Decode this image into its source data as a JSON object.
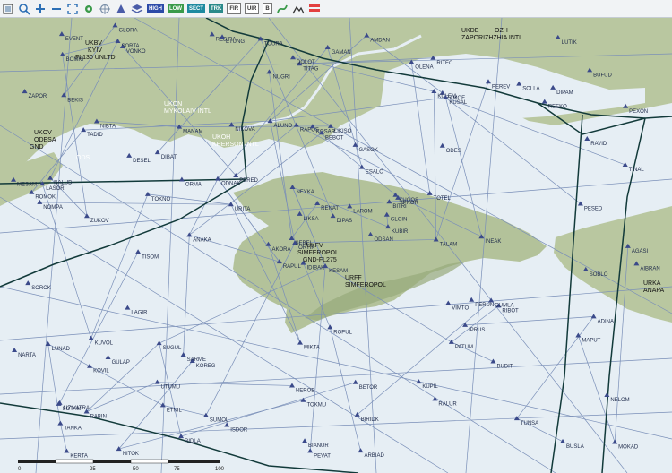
{
  "toolbar": {
    "icons": [
      "layers-icon",
      "search-icon",
      "zoom-in-icon",
      "zoom-out-icon",
      "fit-icon",
      "gear-icon",
      "target-icon",
      "triangle-icon",
      "layer-stack-icon"
    ],
    "buttons": [
      {
        "label": "HIGH",
        "color": "#2c4aa8"
      },
      {
        "label": "LOW",
        "color": "#3a9a4a"
      },
      {
        "label": "SECT",
        "color": "#1e8aa0"
      },
      {
        "label": "TRK",
        "color": "#2a8a8a"
      }
    ],
    "boxes": [
      "FIR",
      "UIR",
      "B"
    ],
    "right_icons": [
      "route-icon",
      "terrain-icon",
      "legend-icon"
    ]
  },
  "airports": [
    {
      "code": "UKBV",
      "name": "KYIV",
      "sub": "FL130 UNLTD"
    },
    {
      "code": "UKON",
      "name": "MYKOLAIV INTL"
    },
    {
      "code": "UKOH",
      "name": "KHERSON INTL"
    },
    {
      "code": "UKOV",
      "name": "ODESA",
      "sub": "GND"
    },
    {
      "code": "ODS",
      "name": "ODESA"
    },
    {
      "code": "UKDE",
      "name": "ZAPORIZHZHIA INTL",
      "code2": "OZH"
    },
    {
      "code": "UKFV",
      "name": "SIMFEROPOL",
      "sub": "GND-FL275"
    },
    {
      "code": "URFF",
      "name": "SIMFEROPOL"
    },
    {
      "code": "URKA",
      "name": "ANAPA"
    }
  ],
  "waypoints": [
    "KESAM",
    "TADID",
    "ORTIK",
    "LIZIVATRA",
    "BITRI",
    "KOREG",
    "RITEC",
    "LIKISO",
    "ZAMOE",
    "ODSAN",
    "VONKO",
    "MOKAD",
    "ZUKOV",
    "PEXON",
    "RAPUL",
    "ODES",
    "NITOK",
    "RAPOS",
    "ESALO",
    "GULAP",
    "PERED",
    "TANKA",
    "ETNIL",
    "KOSAR",
    "IPKOR",
    "RIBOT",
    "NIBTA",
    "TITAG",
    "NOMPA",
    "VIMTO",
    "TINAL",
    "SEBEL",
    "NEROB",
    "LIKSA",
    "MANAM",
    "PEREV",
    "SARME",
    "BUSLA",
    "NELOM",
    "GUMLA",
    "AMDAN",
    "ODNAK",
    "TOKNO",
    "PATUM",
    "RIDLA",
    "MESAM",
    "GLGIN",
    "KERTA",
    "TOKMU",
    "KUBIR",
    "KOVIL",
    "RAVID",
    "ZAPOR",
    "IPRUS",
    "RALUR",
    "UTUMU",
    "SORTA",
    "EVENT",
    "BETOR",
    "DIPAM",
    "GAMAN",
    "ANAKA",
    "NALUD",
    "DIBAT",
    "SOLLA",
    "GLORA",
    "OLENA",
    "NUGRI",
    "RENAT",
    "NARTA",
    "MIKTA",
    "ISDOR",
    "PERUN",
    "ORMA",
    "SOTAM",
    "BOMKI",
    "DESEL",
    "SOROK",
    "NEYKA",
    "BIRIDK",
    "LAROM",
    "RABIN",
    "TALAM",
    "ADINA",
    "BIANUR",
    "PESED",
    "ROPUL",
    "TUNSA",
    "ARBIAD",
    "KUPIL",
    "DOLOT",
    "AIBRAN",
    "TOTEL",
    "BUDIT",
    "DIPAS",
    "MAPUT",
    "LASOR",
    "PEVAT",
    "KULEM",
    "KUSAL",
    "TISOM",
    "REDIRA",
    "AGASI",
    "ROMOK",
    "LAGIR",
    "SUGUL",
    "SUMOL",
    "KUGOS",
    "REEKO",
    "URITA",
    "SOBLO",
    "BEKIS",
    "BEBOT",
    "AKORA",
    "ETUNG",
    "LUNAD",
    "IDIBAK",
    "BUFUD",
    "ALUNO",
    "TOURA",
    "KUVOL",
    "LUTIK",
    "GASOK",
    "NIKOVA",
    "INEAK"
  ],
  "map": {
    "land_color": "#b9c7a0",
    "sea_color": "#e6eef4",
    "boundary_color": "#123a3a"
  },
  "scale": {
    "labels": [
      "0",
      "25",
      "50",
      "75",
      "100"
    ]
  }
}
